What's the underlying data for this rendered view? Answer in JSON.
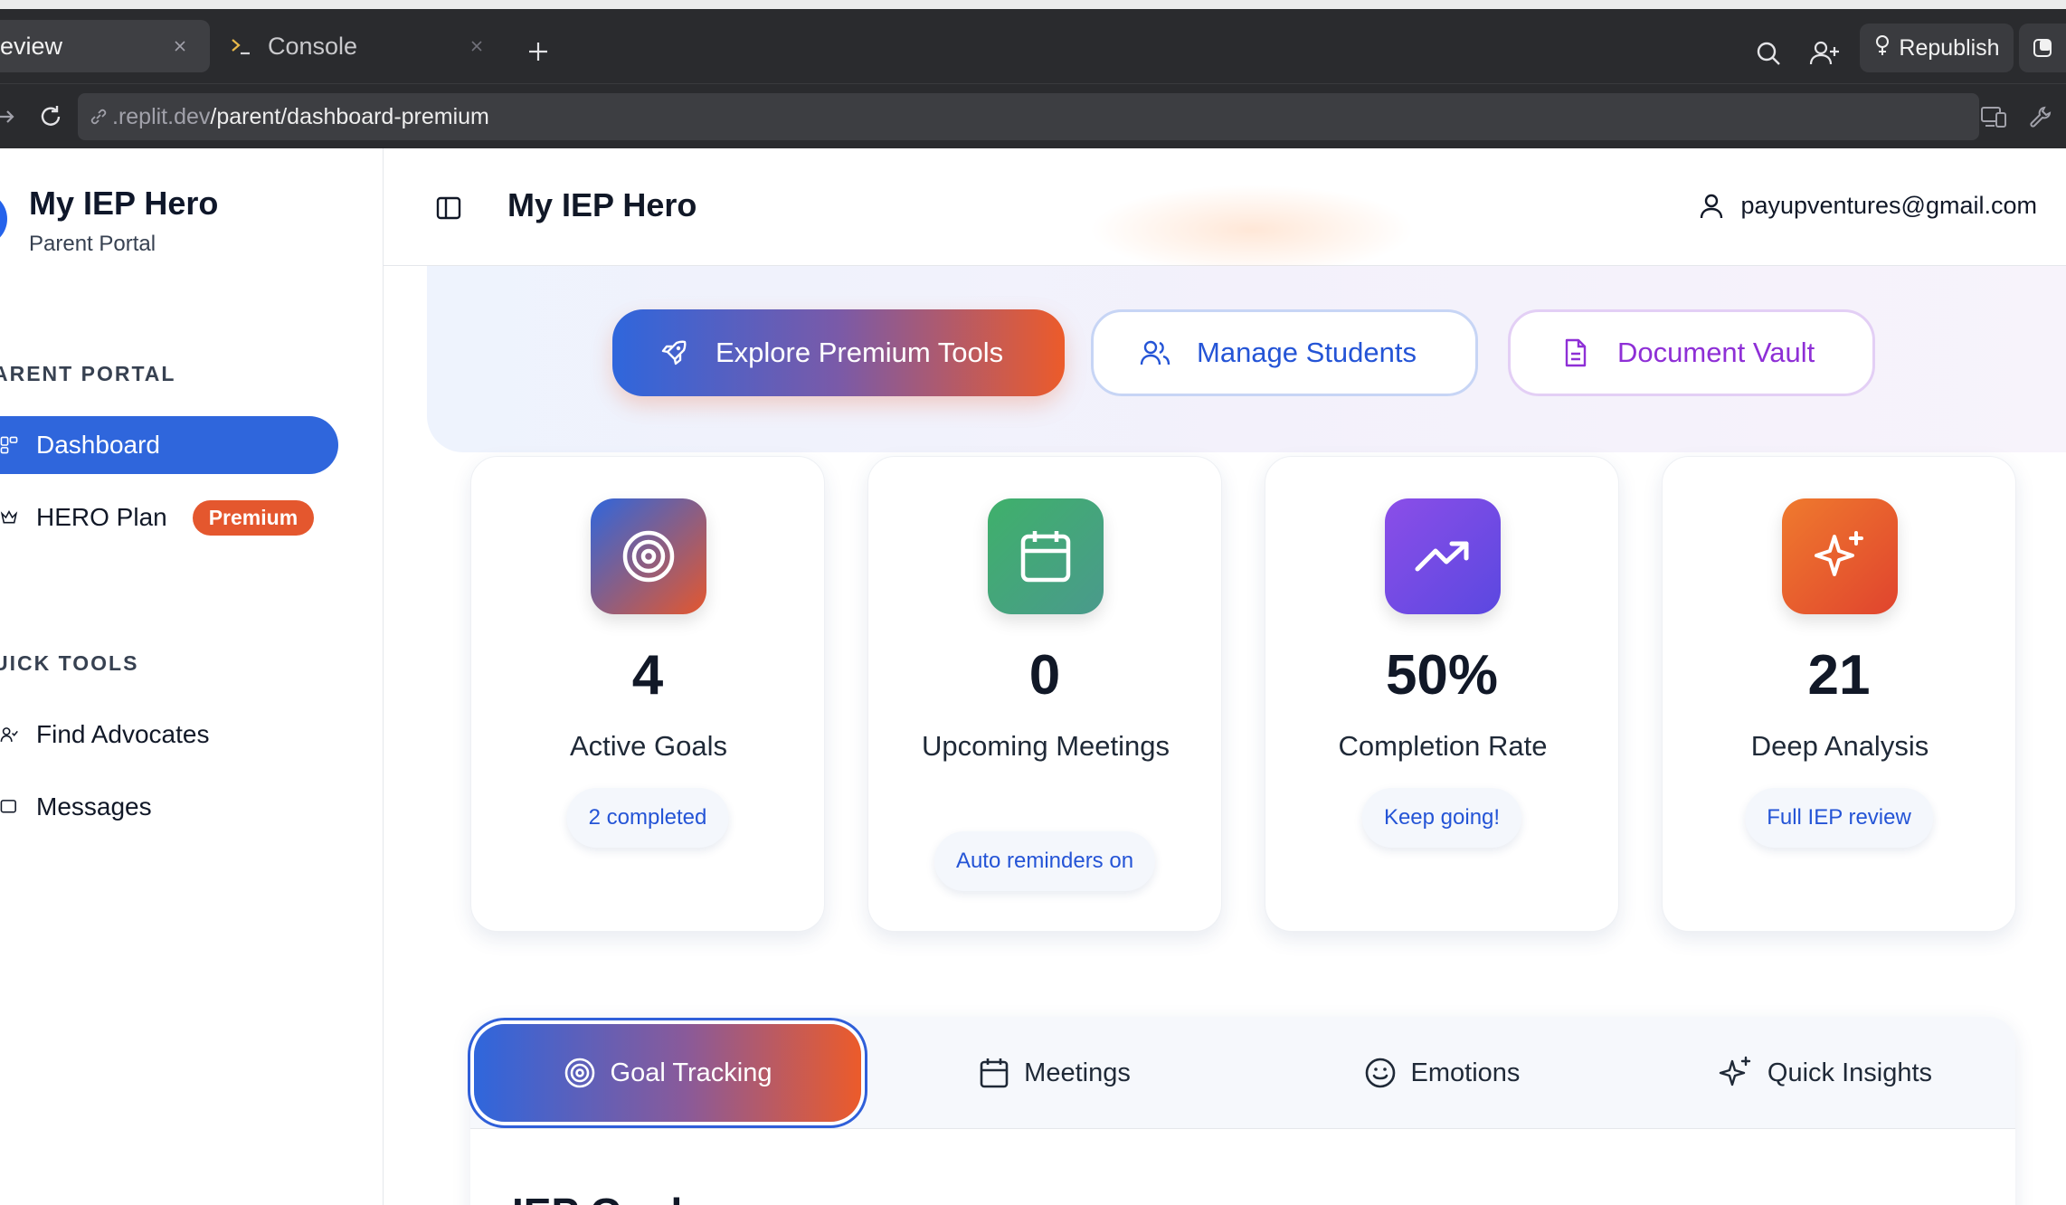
{
  "browser": {
    "tabs": [
      {
        "title": "eview",
        "active": true
      },
      {
        "title": "Console",
        "active": false
      }
    ],
    "republish_label": "Republish",
    "address": {
      "host": ".replit.dev",
      "path": "/parent/dashboard-premium"
    }
  },
  "sidebar": {
    "brand_title": "My IEP Hero",
    "brand_subtitle": "Parent Portal",
    "sections": [
      {
        "label": "ARENT PORTAL"
      },
      {
        "label": "UICK TOOLS"
      }
    ],
    "items": [
      {
        "label": "Dashboard",
        "icon": "dashboard-icon",
        "active": true
      },
      {
        "label": "HERO Plan",
        "icon": "crown-icon",
        "badge": "Premium"
      },
      {
        "label": "Find Advocates",
        "icon": "users-icon"
      },
      {
        "label": "Messages",
        "icon": "message-icon"
      }
    ]
  },
  "header": {
    "title": "My IEP Hero",
    "user_email": "payupventures@gmail.com"
  },
  "hero_actions": [
    {
      "label": "Explore Premium Tools",
      "icon": "rocket-icon"
    },
    {
      "label": "Manage Students",
      "icon": "users-icon"
    },
    {
      "label": "Document Vault",
      "icon": "document-icon"
    }
  ],
  "stats": [
    {
      "value": "4",
      "label": "Active Goals",
      "pill": "2 completed",
      "icon": "target-icon",
      "gradient": [
        "#2f66dc",
        "#e4572e"
      ]
    },
    {
      "value": "0",
      "label": "Upcoming Meetings",
      "pill": "Auto reminders on",
      "icon": "calendar-icon",
      "gradient": [
        "#3fb06b",
        "#4a9a8c"
      ]
    },
    {
      "value": "50%",
      "label": "Completion Rate",
      "pill": "Keep going!",
      "icon": "trending-up-icon",
      "gradient": [
        "#8b4ee8",
        "#5b48e0"
      ]
    },
    {
      "value": "21",
      "label": "Deep Analysis",
      "pill": "Full IEP review",
      "icon": "sparkles-icon",
      "gradient": [
        "#ef7a2e",
        "#e0442e"
      ]
    }
  ],
  "tabs": [
    {
      "label": "Goal Tracking",
      "icon": "target-icon",
      "active": true
    },
    {
      "label": "Meetings",
      "icon": "calendar-icon"
    },
    {
      "label": "Emotions",
      "icon": "smile-icon"
    },
    {
      "label": "Quick Insights",
      "icon": "sparkles-icon"
    }
  ],
  "content_heading_peek": "IEP Goals",
  "colors": {
    "primary": "#2f66dc",
    "accent_orange": "#e4572e",
    "purple": "#8e2fd6",
    "chrome_bg": "#2a2b2e"
  }
}
